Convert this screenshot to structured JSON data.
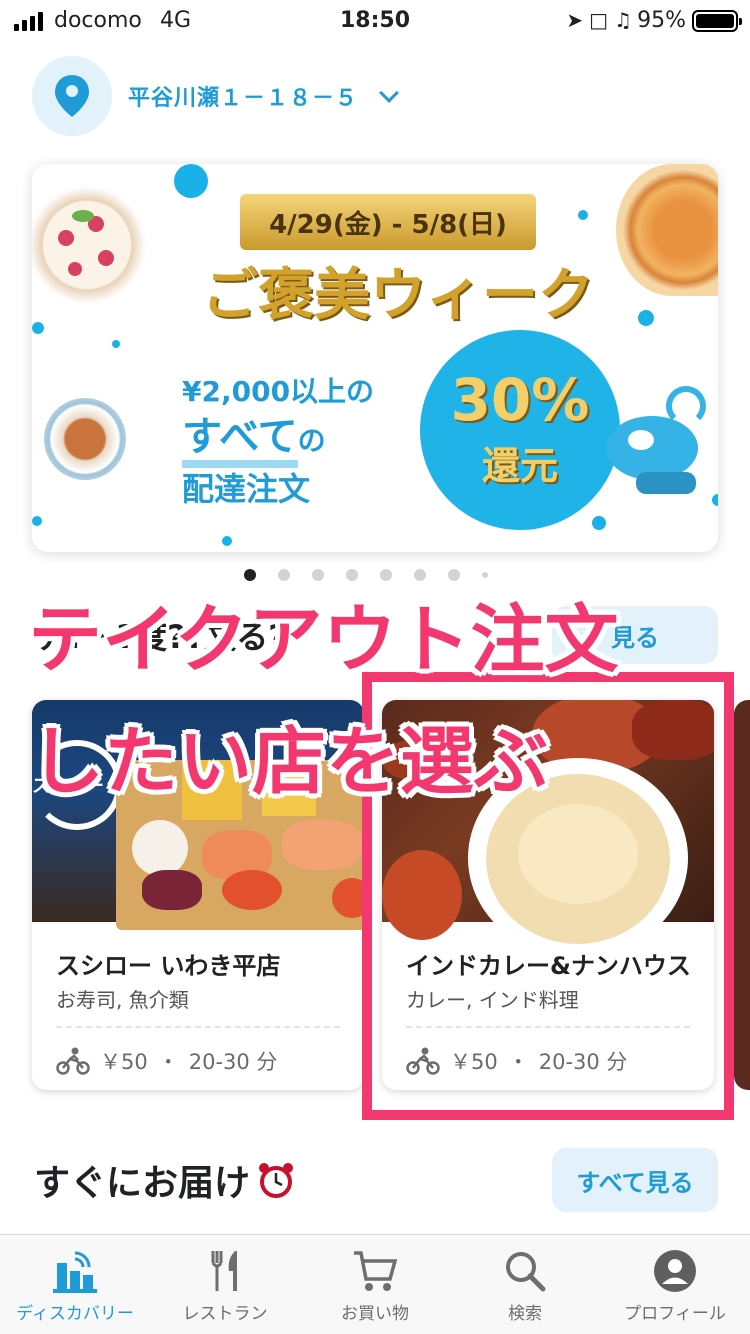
{
  "status_bar": {
    "carrier": "docomo",
    "network": "4G",
    "time": "18:50",
    "battery": "95%"
  },
  "address": {
    "text": "平谷川瀬１－１８－５",
    "icon": "map-pin-icon"
  },
  "banner": {
    "dates": "4/29(金) - 5/8(日)",
    "headline": "ご褒美ウィーク",
    "line1": "¥2,000以上の",
    "line2_em": "すべて",
    "line2_rest": "の",
    "line3": "配達注文",
    "discount": "30%",
    "discount_label": "還元",
    "pages": 8,
    "active_page": 1
  },
  "section1": {
    "title": "テ?ー?度??文る?",
    "see_all": "見る"
  },
  "overlay": {
    "line1": "テイクアウト注文",
    "line2": "したい店を選ぶ",
    "color": "#f2386f"
  },
  "restaurants": [
    {
      "name": "スシロー いわき平店",
      "category": "お寿司, 魚介類",
      "fee": "￥50",
      "sep": "・",
      "time": "20-30 分",
      "photo_logo": "スシロー"
    },
    {
      "name": "インドカレー&ナンハウス",
      "category": "カレー, インド料理",
      "fee": "￥50",
      "sep": "・",
      "time": "20-30 分"
    }
  ],
  "section2": {
    "title": "すぐにお届け",
    "title_icon": "alarm-clock-icon",
    "see_all": "すべて見る"
  },
  "tabs": [
    {
      "label": "ディスカバリー",
      "icon": "discovery-icon",
      "active": true
    },
    {
      "label": "レストラン",
      "icon": "fork-knife-icon",
      "active": false
    },
    {
      "label": "お買い物",
      "icon": "cart-icon",
      "active": false
    },
    {
      "label": "検索",
      "icon": "search-icon",
      "active": false
    },
    {
      "label": "プロフィール",
      "icon": "profile-icon",
      "active": false
    }
  ],
  "colors": {
    "accent": "#1f9bd7",
    "accent_bg": "#e3f1fb",
    "highlight": "#f2386f"
  }
}
